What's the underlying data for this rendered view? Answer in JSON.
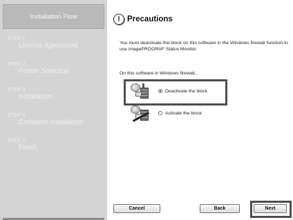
{
  "sidebar": {
    "header": "Installation Flow",
    "steps": [
      {
        "num": "STEP 1",
        "label": "License Agreement"
      },
      {
        "num": "STEP 2",
        "label": "Printer Selection"
      },
      {
        "num": "STEP 3",
        "label": "Installation"
      },
      {
        "num": "STEP 4",
        "label": "Complete Installation"
      },
      {
        "num": "STEP 5",
        "label": "Finish"
      }
    ]
  },
  "main": {
    "title": "Precautions",
    "message": "You must deactivate the block on this software in the Windows firewall function to use imagePROGRAF Status Monitor.",
    "subheading": "On this software in Windows firewall...",
    "options": [
      {
        "label": "Deactivate the block",
        "selected": true
      },
      {
        "label": "Activate the block",
        "selected": false
      }
    ]
  },
  "buttons": {
    "cancel": "Cancel",
    "back": "Back",
    "next": "Next"
  },
  "icons": {
    "title": "warning-icon",
    "firewall": "firewall-icon"
  }
}
